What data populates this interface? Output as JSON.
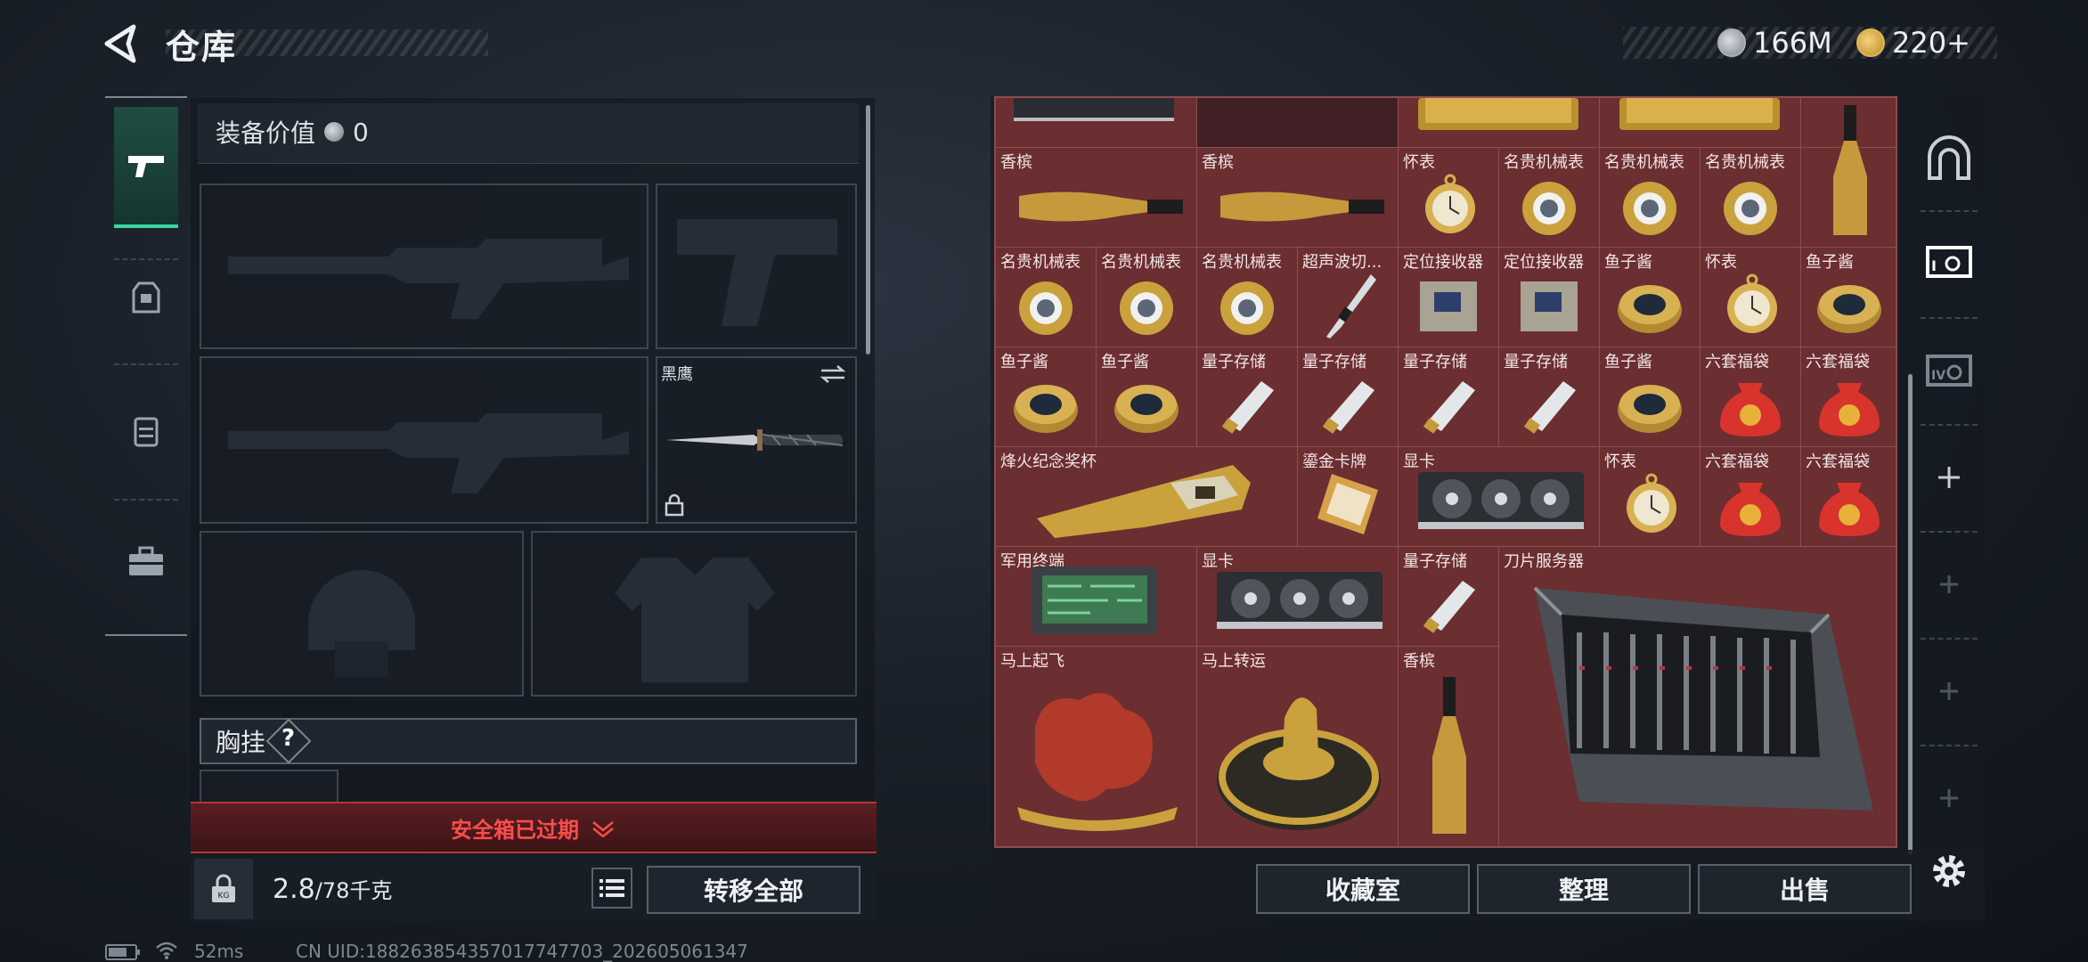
{
  "header": {
    "title": "仓库"
  },
  "currency": {
    "coins": "166M",
    "premium": "220+"
  },
  "equipment": {
    "value_label": "装备价值",
    "value": "0",
    "melee_name": "黑鹰",
    "chest_label": "胸挂",
    "help": "?"
  },
  "safe_box": {
    "text": "安全箱已过期"
  },
  "capacity": {
    "weight": "2.8",
    "max": "/78",
    "unit": "千克"
  },
  "buttons": {
    "transfer_all": "转移全部",
    "collection": "收藏室",
    "organize": "整理",
    "sell": "出售"
  },
  "stash": {
    "labels": {
      "champagne": "香槟",
      "pocket_watch": "怀表",
      "luxury_watch": "名贵机械表",
      "ultrasonic": "超声波切...",
      "locator": "定位接收器",
      "caviar": "鱼子酱",
      "quantum": "量子存储",
      "lucky_bag": "六套福袋",
      "trophy": "烽火纪念奖杯",
      "gold_card": "鎏金卡牌",
      "gpu": "显卡",
      "mil_terminal": "军用终端",
      "blade_server": "刀片服务器",
      "horse_fly": "马上起飞",
      "horse_luck": "马上转运"
    }
  },
  "status_bar": {
    "ping": "52ms",
    "uid": "CN UID:18826385435701774770​3_202605061347"
  },
  "colors": {
    "grid_bg": "#6b2e31",
    "accent_green": "#3fd4a3",
    "warning_red": "#ff4c4c"
  }
}
